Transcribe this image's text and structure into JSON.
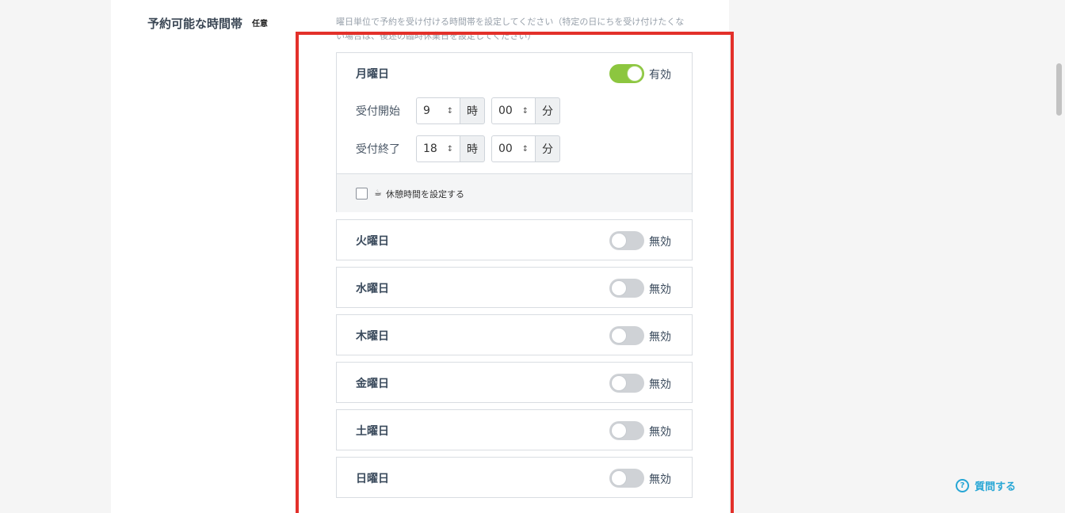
{
  "field": {
    "label": "予約可能な時間帯",
    "optional_badge": "任意",
    "help_text": "曜日単位で予約を受け付ける時間帯を設定してください（特定の日にちを受け付けたくない場合は、後述の臨時休業日を設定してください）"
  },
  "monday": {
    "name": "月曜日",
    "toggle_label": "有効",
    "enabled": true,
    "start": {
      "label": "受付開始",
      "hour": "9",
      "hour_unit": "時",
      "minute": "00",
      "minute_unit": "分"
    },
    "end": {
      "label": "受付終了",
      "hour": "18",
      "hour_unit": "時",
      "minute": "00",
      "minute_unit": "分"
    },
    "break_label": "休憩時間を設定する",
    "break_checked": false
  },
  "days": [
    {
      "name": "火曜日",
      "toggle_label": "無効",
      "enabled": false
    },
    {
      "name": "水曜日",
      "toggle_label": "無効",
      "enabled": false
    },
    {
      "name": "木曜日",
      "toggle_label": "無効",
      "enabled": false
    },
    {
      "name": "金曜日",
      "toggle_label": "無効",
      "enabled": false
    },
    {
      "name": "土曜日",
      "toggle_label": "無効",
      "enabled": false
    },
    {
      "name": "日曜日",
      "toggle_label": "無効",
      "enabled": false
    }
  ],
  "help_button": {
    "label": "質問する",
    "icon": "question-circle-icon"
  },
  "colors": {
    "toggle_on": "#8cc63f",
    "toggle_off": "#cfd2d6",
    "highlight": "#e3302a",
    "help": "#27a6d5"
  }
}
